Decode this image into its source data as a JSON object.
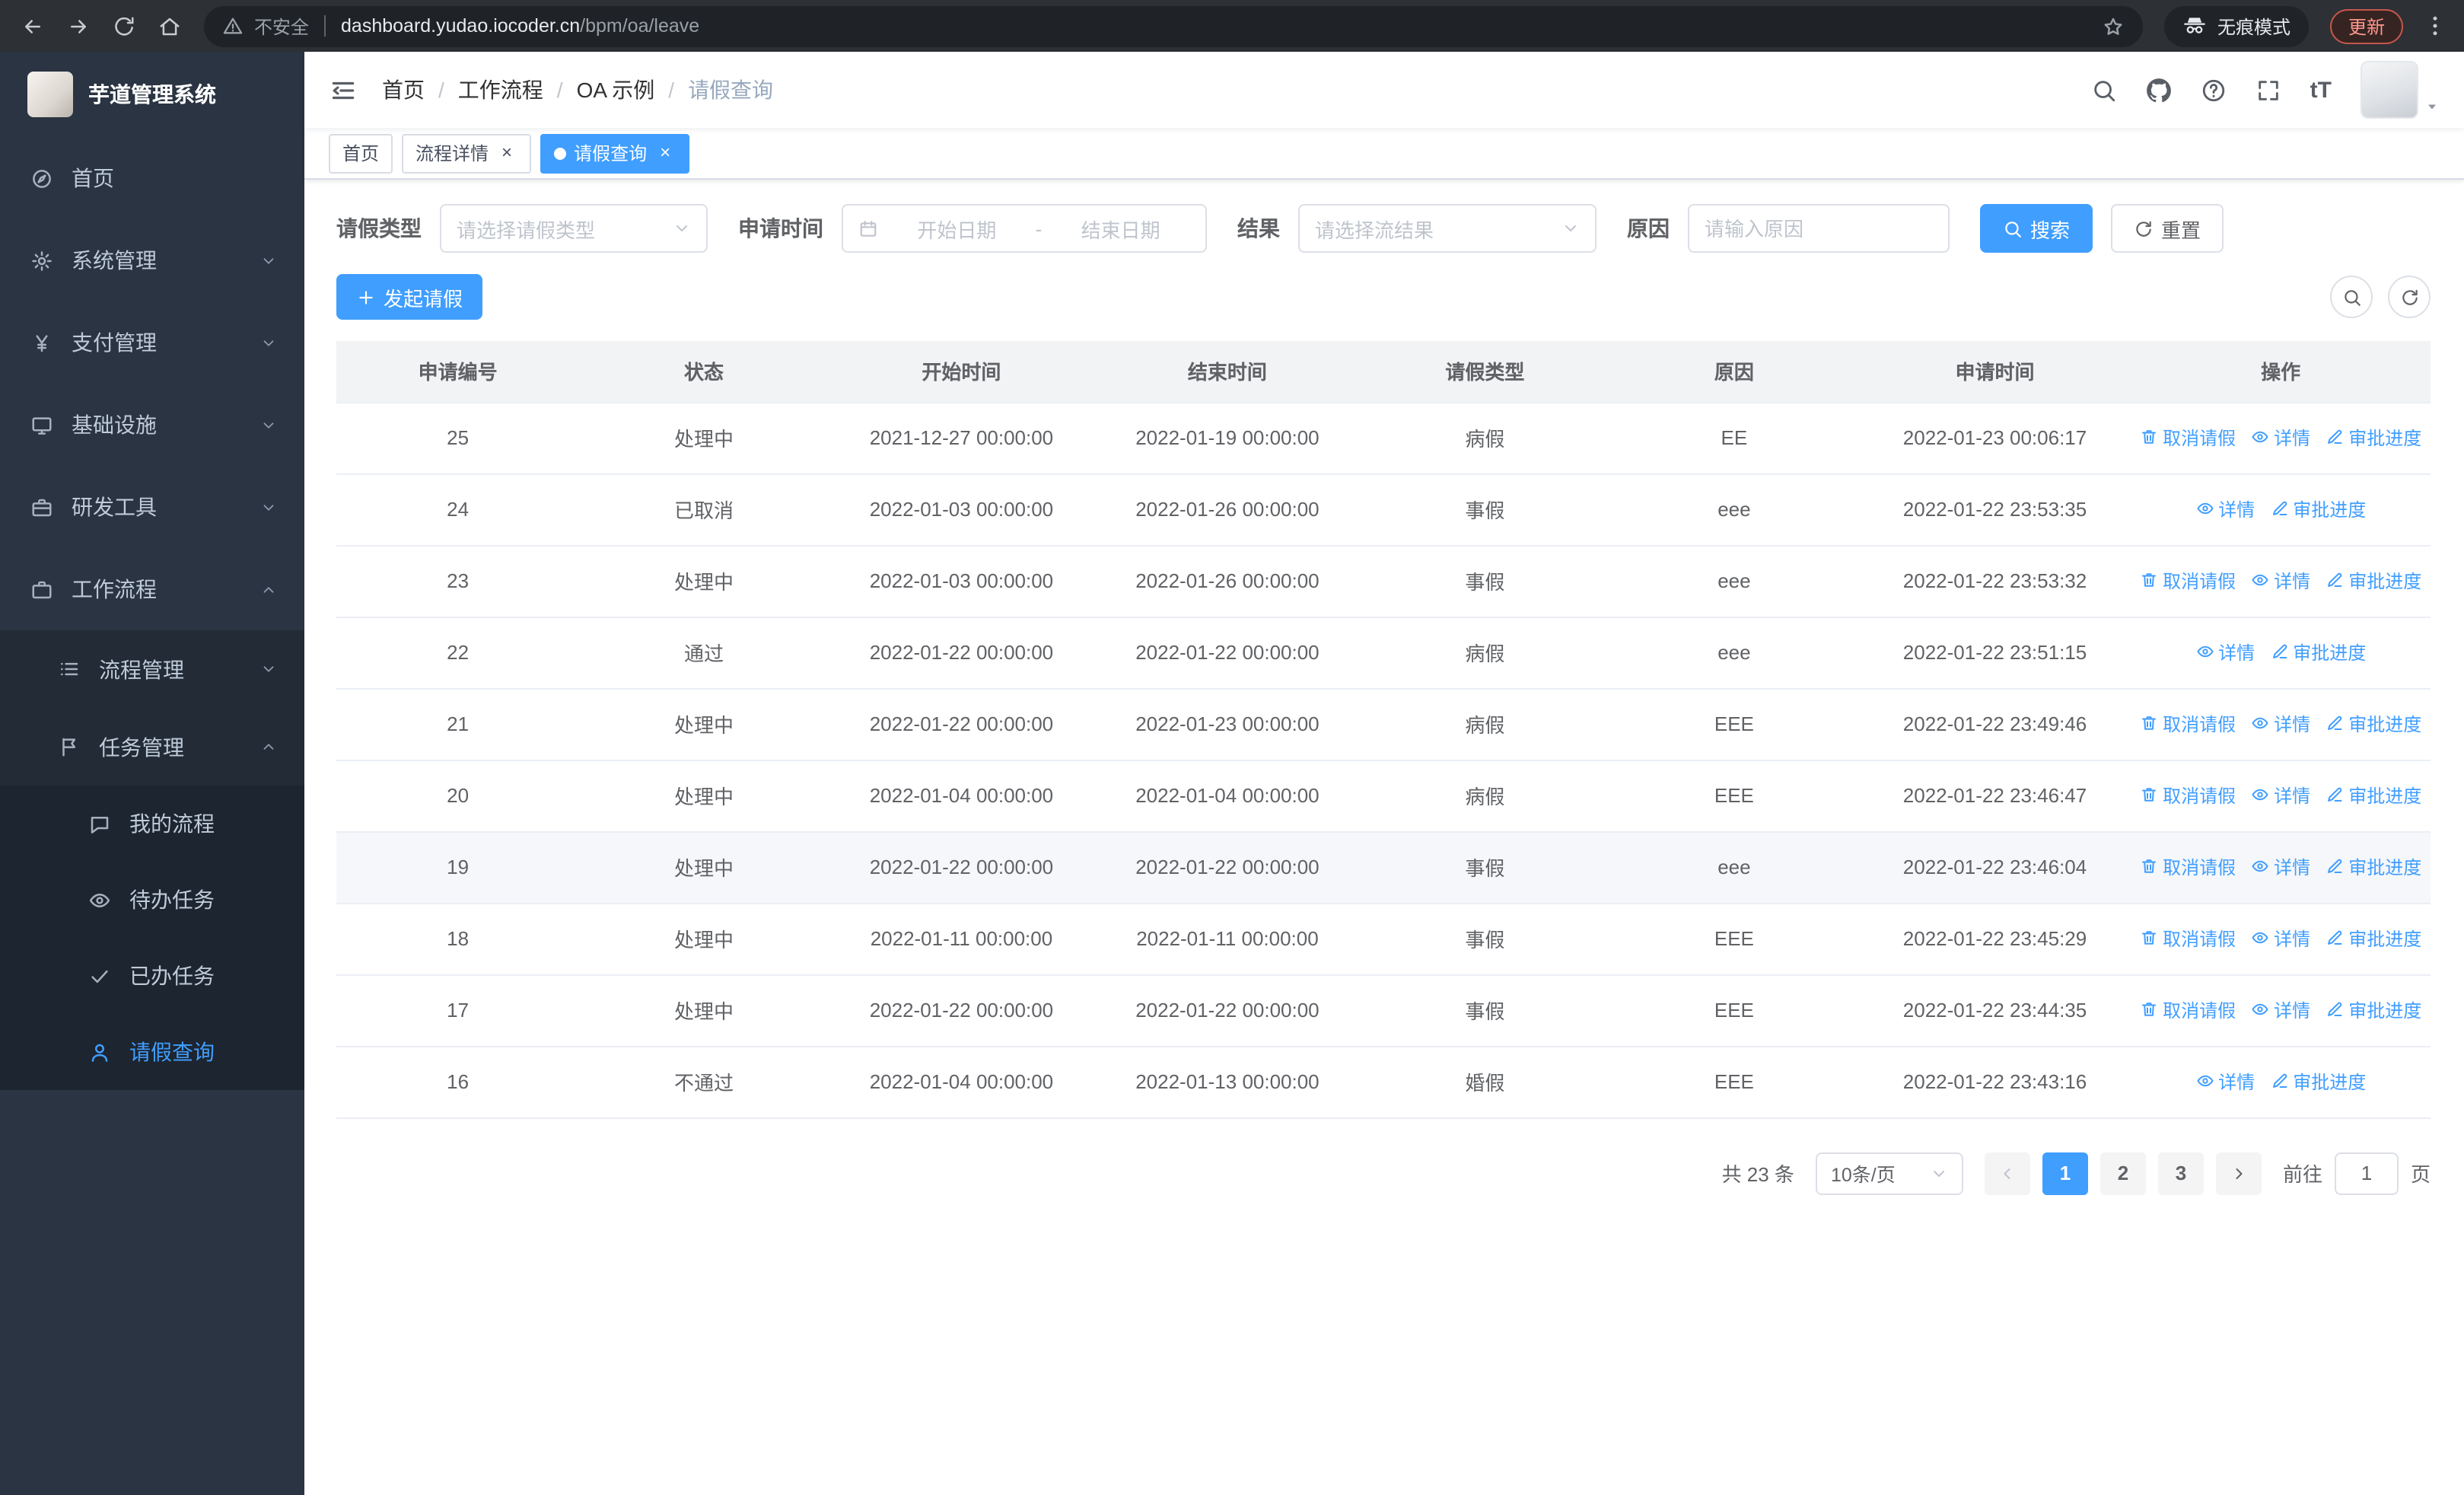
{
  "browser": {
    "security_label": "不安全",
    "url_domain": "dashboard.yudao.iocoder.cn",
    "url_path": "/bpm/oa/leave",
    "incognito_label": "无痕模式",
    "update_label": "更新"
  },
  "sidebar": {
    "logo_title": "芋道管理系统",
    "menu": [
      {
        "key": "home",
        "label": "首页",
        "icon": "dashboard-icon",
        "level": 1
      },
      {
        "key": "system-management",
        "label": "系统管理",
        "icon": "gear-icon",
        "level": 1,
        "arrow": "down"
      },
      {
        "key": "payment-management",
        "label": "支付管理",
        "icon": "yen-icon",
        "level": 1,
        "arrow": "down"
      },
      {
        "key": "infrastructure",
        "label": "基础设施",
        "icon": "monitor-icon",
        "level": 1,
        "arrow": "down"
      },
      {
        "key": "dev-tools",
        "label": "研发工具",
        "icon": "toolbox-icon",
        "level": 1,
        "arrow": "down"
      },
      {
        "key": "workflow",
        "label": "工作流程",
        "icon": "briefcase-icon",
        "level": 1,
        "arrow": "up"
      },
      {
        "key": "process-management",
        "label": "流程管理",
        "icon": "list-icon",
        "level": 2,
        "arrow": "down"
      },
      {
        "key": "task-management",
        "label": "任务管理",
        "icon": "flag-icon",
        "level": 2,
        "arrow": "up"
      },
      {
        "key": "my-process",
        "label": "我的流程",
        "icon": "chat-icon",
        "level": 3
      },
      {
        "key": "todo-tasks",
        "label": "待办任务",
        "icon": "eye-icon",
        "level": 3
      },
      {
        "key": "done-tasks",
        "label": "已办任务",
        "icon": "check-icon",
        "level": 3
      },
      {
        "key": "leave-query",
        "label": "请假查询",
        "icon": "user-icon",
        "level": 3,
        "active": true
      }
    ]
  },
  "header": {
    "breadcrumb": [
      "首页",
      "工作流程",
      "OA 示例",
      "请假查询"
    ]
  },
  "tabs": [
    {
      "key": "home",
      "label": "首页",
      "closable": false,
      "active": false
    },
    {
      "key": "process-detail",
      "label": "流程详情",
      "closable": true,
      "active": false
    },
    {
      "key": "leave-query",
      "label": "请假查询",
      "closable": true,
      "active": true
    }
  ],
  "filters": {
    "leave_type_label": "请假类型",
    "leave_type_placeholder": "请选择请假类型",
    "apply_time_label": "申请时间",
    "start_date_placeholder": "开始日期",
    "range_separator": "-",
    "end_date_placeholder": "结束日期",
    "result_label": "结果",
    "result_placeholder": "请选择流结果",
    "reason_label": "原因",
    "reason_placeholder": "请输入原因",
    "search_label": "搜索",
    "reset_label": "重置"
  },
  "toolbar": {
    "create_label": "发起请假"
  },
  "table": {
    "columns": [
      {
        "key": "apply-id",
        "label": "申请编号"
      },
      {
        "key": "status",
        "label": "状态"
      },
      {
        "key": "start-time",
        "label": "开始时间"
      },
      {
        "key": "end-time",
        "label": "结束时间"
      },
      {
        "key": "leave-type",
        "label": "请假类型"
      },
      {
        "key": "reason",
        "label": "原因"
      },
      {
        "key": "apply-time",
        "label": "申请时间"
      },
      {
        "key": "actions",
        "label": "操作"
      }
    ],
    "action_defs": {
      "cancel": {
        "label": "取消请假",
        "icon": "trash-icon"
      },
      "detail": {
        "label": "详情",
        "icon": "eye-icon"
      },
      "progress": {
        "label": "审批进度",
        "icon": "edit-icon"
      }
    },
    "rows": [
      {
        "id": "25",
        "status": "处理中",
        "start": "2021-12-27 00:00:00",
        "end": "2022-01-19 00:00:00",
        "type": "病假",
        "reason": "EE",
        "applied": "2022-01-23 00:06:17",
        "actions": [
          "cancel",
          "detail",
          "progress"
        ]
      },
      {
        "id": "24",
        "status": "已取消",
        "start": "2022-01-03 00:00:00",
        "end": "2022-01-26 00:00:00",
        "type": "事假",
        "reason": "eee",
        "applied": "2022-01-22 23:53:35",
        "actions": [
          "detail",
          "progress"
        ]
      },
      {
        "id": "23",
        "status": "处理中",
        "start": "2022-01-03 00:00:00",
        "end": "2022-01-26 00:00:00",
        "type": "事假",
        "reason": "eee",
        "applied": "2022-01-22 23:53:32",
        "actions": [
          "cancel",
          "detail",
          "progress"
        ]
      },
      {
        "id": "22",
        "status": "通过",
        "start": "2022-01-22 00:00:00",
        "end": "2022-01-22 00:00:00",
        "type": "病假",
        "reason": "eee",
        "applied": "2022-01-22 23:51:15",
        "actions": [
          "detail",
          "progress"
        ]
      },
      {
        "id": "21",
        "status": "处理中",
        "start": "2022-01-22 00:00:00",
        "end": "2022-01-23 00:00:00",
        "type": "病假",
        "reason": "EEE",
        "applied": "2022-01-22 23:49:46",
        "actions": [
          "cancel",
          "detail",
          "progress"
        ]
      },
      {
        "id": "20",
        "status": "处理中",
        "start": "2022-01-04 00:00:00",
        "end": "2022-01-04 00:00:00",
        "type": "病假",
        "reason": "EEE",
        "applied": "2022-01-22 23:46:47",
        "actions": [
          "cancel",
          "detail",
          "progress"
        ]
      },
      {
        "id": "19",
        "status": "处理中",
        "start": "2022-01-22 00:00:00",
        "end": "2022-01-22 00:00:00",
        "type": "事假",
        "reason": "eee",
        "applied": "2022-01-22 23:46:04",
        "actions": [
          "cancel",
          "detail",
          "progress"
        ],
        "highlighted": true
      },
      {
        "id": "18",
        "status": "处理中",
        "start": "2022-01-11 00:00:00",
        "end": "2022-01-11 00:00:00",
        "type": "事假",
        "reason": "EEE",
        "applied": "2022-01-22 23:45:29",
        "actions": [
          "cancel",
          "detail",
          "progress"
        ]
      },
      {
        "id": "17",
        "status": "处理中",
        "start": "2022-01-22 00:00:00",
        "end": "2022-01-22 00:00:00",
        "type": "事假",
        "reason": "EEE",
        "applied": "2022-01-22 23:44:35",
        "actions": [
          "cancel",
          "detail",
          "progress"
        ]
      },
      {
        "id": "16",
        "status": "不通过",
        "start": "2022-01-04 00:00:00",
        "end": "2022-01-13 00:00:00",
        "type": "婚假",
        "reason": "EEE",
        "applied": "2022-01-22 23:43:16",
        "actions": [
          "detail",
          "progress"
        ]
      }
    ]
  },
  "pagination": {
    "total_text": "共 23 条",
    "page_size_text": "10条/页",
    "pages": [
      "1",
      "2",
      "3"
    ],
    "active_page": "1",
    "goto_label": "前往",
    "goto_value": "1",
    "unit_label": "页"
  },
  "colors": {
    "primary": "#409eff",
    "sidebar_bg": "#2a3442",
    "submenu_bg": "#222b36",
    "deep_menu_bg": "#1d2530"
  }
}
